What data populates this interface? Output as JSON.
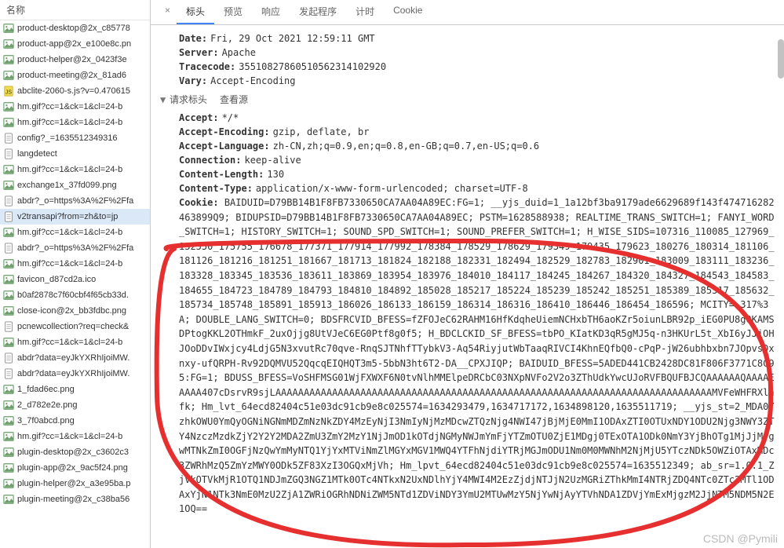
{
  "sidebar": {
    "header": "名称",
    "items": [
      {
        "name": "product-desktop@2x_c85778",
        "type": "image"
      },
      {
        "name": "product-app@2x_e100e8c.pn",
        "type": "image"
      },
      {
        "name": "product-helper@2x_0423f3e",
        "type": "image"
      },
      {
        "name": "product-meeting@2x_81ad6",
        "type": "image"
      },
      {
        "name": "abclite-2060-s.js?v=0.470615",
        "type": "js"
      },
      {
        "name": "hm.gif?cc=1&ck=1&cl=24-b",
        "type": "image"
      },
      {
        "name": "hm.gif?cc=1&ck=1&cl=24-b",
        "type": "image"
      },
      {
        "name": "config?_=1635512349316",
        "type": "doc"
      },
      {
        "name": "langdetect",
        "type": "doc"
      },
      {
        "name": "hm.gif?cc=1&ck=1&cl=24-b",
        "type": "image"
      },
      {
        "name": "exchange1x_37fd099.png",
        "type": "image"
      },
      {
        "name": "abdr?_o=https%3A%2F%2Ffa",
        "type": "doc"
      },
      {
        "name": "v2transapi?from=zh&to=jp",
        "type": "doc",
        "selected": true
      },
      {
        "name": "hm.gif?cc=1&ck=1&cl=24-b",
        "type": "image"
      },
      {
        "name": "abdr?_o=https%3A%2F%2Ffa",
        "type": "doc"
      },
      {
        "name": "hm.gif?cc=1&ck=1&cl=24-b",
        "type": "image"
      },
      {
        "name": "favicon_d87cd2a.ico",
        "type": "image"
      },
      {
        "name": "b0af2878c7f60cbf4f65cb33d.",
        "type": "image"
      },
      {
        "name": "close-icon@2x_bb3fdbc.png",
        "type": "image"
      },
      {
        "name": "pcnewcollection?req=check&",
        "type": "doc"
      },
      {
        "name": "hm.gif?cc=1&ck=1&cl=24-b",
        "type": "image"
      },
      {
        "name": "abdr?data=eyJkYXRhIjoiMW.",
        "type": "doc"
      },
      {
        "name": "abdr?data=eyJkYXRhIjoiMW.",
        "type": "doc"
      },
      {
        "name": "1_fdad6ec.png",
        "type": "image"
      },
      {
        "name": "2_d782e2e.png",
        "type": "image"
      },
      {
        "name": "3_7f0abcd.png",
        "type": "image"
      },
      {
        "name": "hm.gif?cc=1&ck=1&cl=24-b",
        "type": "image"
      },
      {
        "name": "plugin-desktop@2x_c3602c3",
        "type": "image"
      },
      {
        "name": "plugin-app@2x_9ac5f24.png",
        "type": "image"
      },
      {
        "name": "plugin-helper@2x_a3e95ba.p",
        "type": "image"
      },
      {
        "name": "plugin-meeting@2x_c38ba56",
        "type": "image"
      }
    ]
  },
  "tabs": {
    "prefix": "×",
    "items": [
      "标头",
      "预览",
      "响应",
      "发起程序",
      "计时",
      "Cookie"
    ],
    "active_index": 0
  },
  "response_headers": [
    {
      "k": "Date:",
      "v": "Fri, 29 Oct 2021 12:59:11 GMT"
    },
    {
      "k": "Server:",
      "v": "Apache"
    },
    {
      "k": "Tracecode:",
      "v": "35510827860510562314102920"
    },
    {
      "k": "Vary:",
      "v": "Accept-Encoding"
    }
  ],
  "section": {
    "title": "请求标头",
    "view_source": "查看源"
  },
  "request_headers": [
    {
      "k": "Accept:",
      "v": "*/*"
    },
    {
      "k": "Accept-Encoding:",
      "v": "gzip, deflate, br"
    },
    {
      "k": "Accept-Language:",
      "v": "zh-CN,zh;q=0.9,en;q=0.8,en-GB;q=0.7,en-US;q=0.6"
    },
    {
      "k": "Connection:",
      "v": "keep-alive"
    },
    {
      "k": "Content-Length:",
      "v": "130"
    },
    {
      "k": "Content-Type:",
      "v": "application/x-www-form-urlencoded; charset=UTF-8"
    }
  ],
  "cookie": {
    "key": "Cookie:",
    "value": "BAIDUID=D79BB14B1F8FB7330650CA7AA04A89EC:FG=1; __yjs_duid=1_1a12bf3ba9179ade6629689f143f474716282463899Q9; BIDUPSID=D79BB14B1F8FB7330650CA7AA04A89EC; PSTM=1628588938; REALTIME_TRANS_SWITCH=1; FANYI_WORD_SWITCH=1; HISTORY_SWITCH=1; SOUND_SPD_SWITCH=1; SOUND_PREFER_SWITCH=1; H_WISE_SIDS=107316_110085_127969_132550_175755_176678_177371_177914_177992_178384_178529_178629_179349_179435_179623_180276_180314_181106_181126_181216_181251_181667_181713_181824_182188_182331_182494_182529_182783_182901_183009_183111_183236_183328_183345_183536_183611_183869_183954_183976_184010_184117_184245_184267_184320_184327_184543_184583_184655_184723_184789_184793_184810_184892_185028_185217_185224_185239_185242_185251_185389_185517_185632_185734_185748_185891_185913_186026_186133_186159_186314_186316_186410_186446_186454_186596; MCITY=-317%3A; DOUBLE_LANG_SWITCH=0; BDSFRCVID_BFESS=fZFOJeC62RAHM16HfKdqheUiemNCHxbTH6aoKZr5oiunLBR92p_iEG0PU8g0KAMSDPtogKKL2OTHmkF_2uxOjjg8UtVJeC6EG0Ptf8g0f5; H_BDCLCKID_SF_BFESS=tbPO_KIatKD3qR5gMJ5q-n3HKUrL5t_XbI6yJJjOHJOoDDvIWxjcy4LdjG5N3xvutRc70qve-RnqSJTNhfTTybkV3-Aq54RiyjutWbTaaqRIVCI4KhnEQfbQ0-cPqP-jW26ubhbxbn7JOpvsDxnxy-ufQRPH-Rv92DQMVU52QqcqEIQHQT3m5-5bbN3ht6T2-DA__CPXJIQP; BAIDUID_BFESS=5ADED441CB2428DC81F806F3771C8C95:FG=1; BDUSS_BFESS=VoSHFMSG01WjFXWXF6N0tvNlhMMElpeDRCbC03NXpNVFo2V2o3ZThUdkYwcUJoRVFBQUFBJCQAAAAAAQAAAAEAAAA407cDsrvR9sjLAAAAAAAAAAAAAAAAAAAAAAAAAAAAAAAAAAAAAAAAAAAAAAAAAAAAAAAAAAAAAAAAAAAAAAAAAAAAAMVFeWHFRXlhfk; Hm_lvt_64ecd82404c51e03dc91cb9e8c025574=1634293479,1634717172,1634898120,1635511719; __yjs_st=2_MDA0YzhkOWU0YmQyOGNiNGNmMDZmNzNkZDY4MzEyNjI3NmIyNjMzMDcwZTQzNjg4NWI47jBjMjE0MmI1ODAxZTI0OTUxNDY1ODU2Njg3NWY3ZTY4NzczMzdkZjY2Y2Y2MDA2ZmU3ZmY2MzY1NjJmOD1kOTdjNGMyNWJmYmFjYTZmOTU0ZjE1MDgj0TExOTA1ODk0NmY3YjBhOTg1MjJjMjgwMTNkZmI0OGFjNzQwYmMyNTQ1YjYxMTViNmZlMGYxMGV1MWQ4YTFhNjdiYTRjMGJmODU1Nm0M0MWNhM2NjMjU5YTczNDk5OWZiOTAxMDc3ZWRhMzQ5ZmYzMWY0ODk5ZF83XzI3OGQxMjVh; Hm_lpvt_64ecd82404c51e03dc91cb9e8c025574=1635512349; ab_sr=1.0.1_ZjVkOTVkMjR1OTQ1NDJmZGQ3NGZ1MTk0OTc4NTkxN2UxNDlhYjY4MWI4M2EzZjdjNTJjN2UzMGRiZThkMmI4NTRjZDQ4NTc0ZTc2MTl1ODAxYjN1NTk3NmE0MzU2ZjA1ZWRiOGRhNDNiZWM5NTd1ZDViNDY3YmU2MTUwMzY5NjYwNjAyYTVhNDA1ZDVjYmExMjgzM2JjNTM5NDM5N2E1OQ=="
  },
  "watermark": "CSDN @Pymili"
}
